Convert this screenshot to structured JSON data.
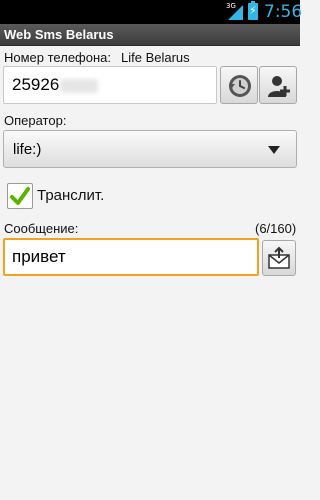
{
  "status_bar": {
    "network_type": "3G",
    "time": "7:56",
    "signal_icon": "signal-icon",
    "battery_icon": "battery-charging-icon"
  },
  "app": {
    "title": "Web Sms Belarus"
  },
  "phone": {
    "label": "Номер телефона:",
    "operator_detected": "Life Belarus",
    "value_visible": "25926",
    "history_icon": "history-icon",
    "add_contact_icon": "add-contact-icon"
  },
  "operator": {
    "label": "Оператор:",
    "selected": "life:)"
  },
  "translit": {
    "label": "Транслит.",
    "checked": true
  },
  "message": {
    "label": "Сообщение:",
    "counter": "(6/160)",
    "value": "привет",
    "send_icon": "send-icon"
  },
  "colors": {
    "status_accent": "#33b5e5",
    "title_bar": "#4a4a4a",
    "focus_border": "#f2a21f",
    "check_green": "#5ab300"
  }
}
